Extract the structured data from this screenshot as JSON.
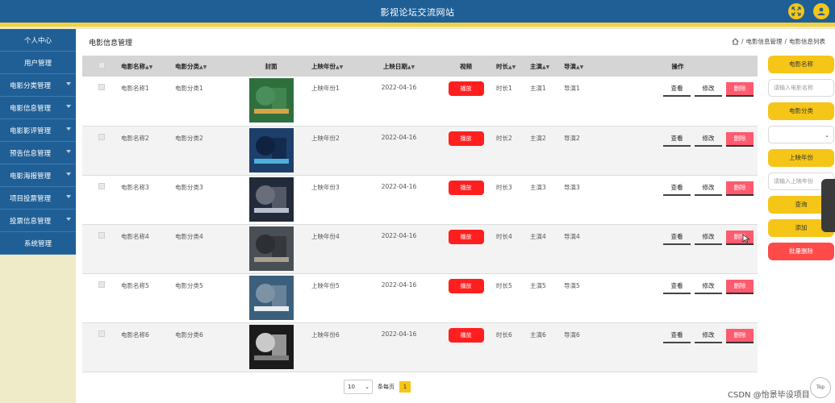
{
  "header": {
    "title": "影视论坛交流网站"
  },
  "sidebar": {
    "items": [
      {
        "label": "个人中心"
      },
      {
        "label": "用户管理"
      },
      {
        "label": "电影分类管理"
      },
      {
        "label": "电影信息管理"
      },
      {
        "label": "电影影评管理"
      },
      {
        "label": "预告信息管理"
      },
      {
        "label": "电影海报管理"
      },
      {
        "label": "项目投票管理"
      },
      {
        "label": "投票信息管理"
      },
      {
        "label": "系统管理"
      }
    ]
  },
  "page": {
    "title": "电影信息管理",
    "breadcrumb": [
      "电影信息管理",
      "电影信息列表"
    ]
  },
  "table": {
    "headers": {
      "name": "电影名称",
      "category": "电影分类",
      "cover": "封面",
      "year": "上映年份",
      "date": "上映日期",
      "video": "视频",
      "duration": "时长",
      "lead": "主演",
      "director": "导演",
      "ops": "操作"
    },
    "buttons": {
      "play": "播放",
      "view": "查看",
      "edit": "修改",
      "delete": "删除"
    },
    "rows": [
      {
        "name": "电影名称1",
        "category": "电影分类1",
        "year": "上映年份1",
        "date": "2022-04-16",
        "duration": "时长1",
        "lead": "主演1",
        "director": "导演1"
      },
      {
        "name": "电影名称2",
        "category": "电影分类2",
        "year": "上映年份2",
        "date": "2022-04-16",
        "duration": "时长2",
        "lead": "主演2",
        "director": "导演2"
      },
      {
        "name": "电影名称3",
        "category": "电影分类3",
        "year": "上映年份3",
        "date": "2022-04-16",
        "duration": "时长3",
        "lead": "主演3",
        "director": "导演3"
      },
      {
        "name": "电影名称4",
        "category": "电影分类4",
        "year": "上映年份4",
        "date": "2022-04-16",
        "duration": "时长4",
        "lead": "主演4",
        "director": "导演4"
      },
      {
        "name": "电影名称5",
        "category": "电影分类5",
        "year": "上映年份5",
        "date": "2022-04-16",
        "duration": "时长5",
        "lead": "主演5",
        "director": "导演5"
      },
      {
        "name": "电影名称6",
        "category": "电影分类6",
        "year": "上映年份6",
        "date": "2022-04-16",
        "duration": "时长6",
        "lead": "主演6",
        "director": "导演6"
      }
    ]
  },
  "filters": {
    "name_label": "电影名称",
    "name_placeholder": "请输入电影名称",
    "category_label": "电影分类",
    "category_value": "",
    "year_label": "上映年份",
    "year_placeholder": "请输入上映年份",
    "query_label": "查询",
    "add_label": "添加",
    "batch_delete_label": "批量删除"
  },
  "pagination": {
    "page_size": "10",
    "per_page_label": "条每页",
    "current_page": "1"
  },
  "top_button_label": "Top",
  "watermark": "CSDN @怡景毕设项目",
  "colors": {
    "header": "#1f5f96",
    "accent_yellow": "#f5c518",
    "danger_red": "#ff1f1f",
    "sidebar_bg": "#efeac7"
  },
  "icons": {
    "fullscreen": "expand-arrows-icon",
    "user": "user-avatar-icon",
    "home": "home-icon"
  }
}
